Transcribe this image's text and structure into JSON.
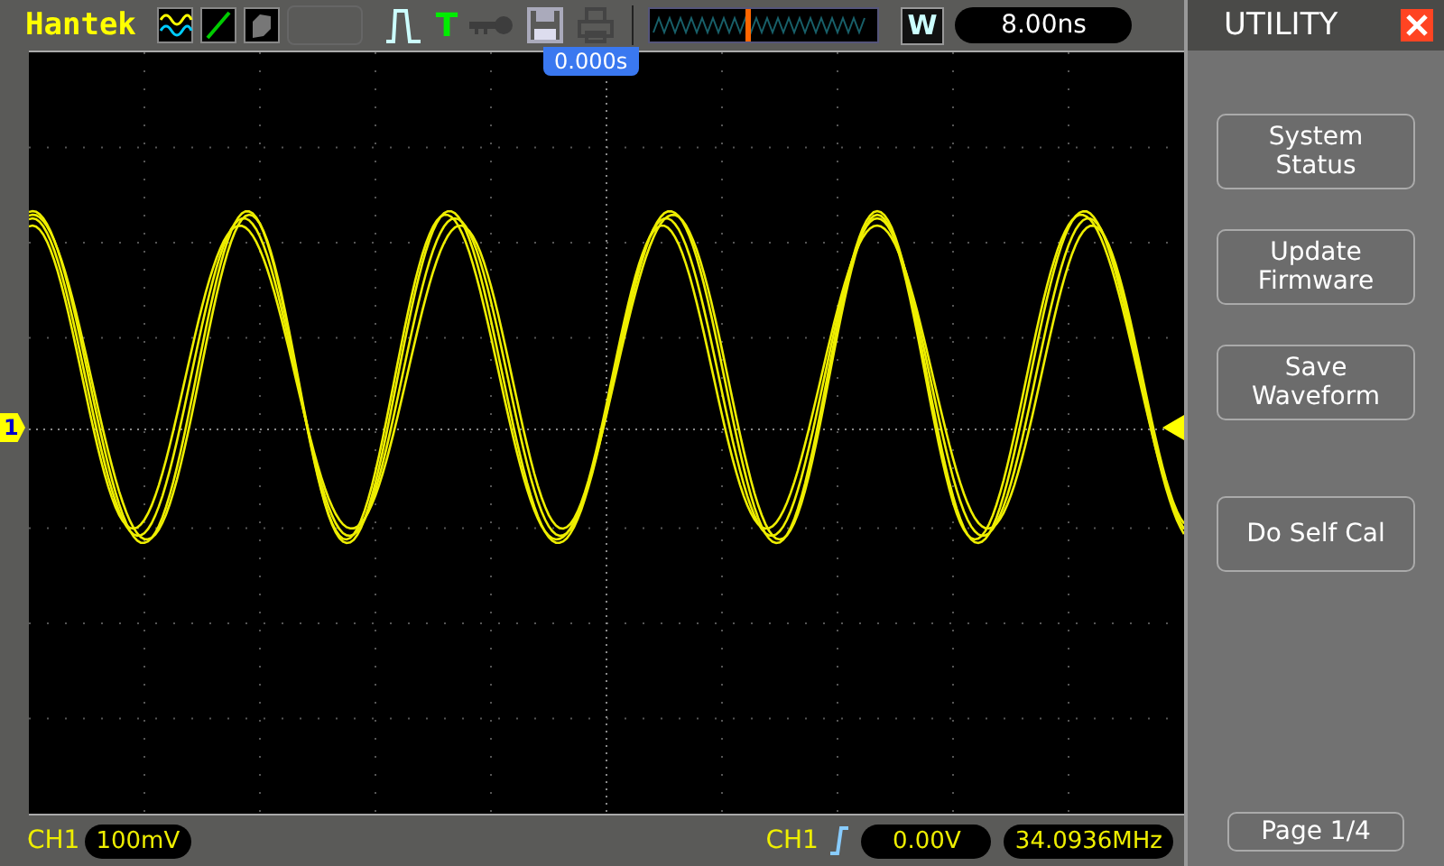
{
  "toolbar": {
    "brand": "Hantek",
    "trigger_status": "T",
    "window_mode": "W",
    "timebase": "8.00ns"
  },
  "plot": {
    "trigger_time": "0.000s",
    "channel_marker": "1"
  },
  "status_bar": {
    "channel": "CH1",
    "channel_scale": "100mV",
    "trigger_source": "CH1",
    "trigger_level": "0.00V",
    "frequency": "34.0936MHz"
  },
  "menu": {
    "title": "UTILITY",
    "items": [
      {
        "label": "System Status"
      },
      {
        "label": "Update Firmware"
      },
      {
        "label": "Save Waveform"
      },
      {
        "label": "Do Self Cal"
      }
    ],
    "page": "Page 1/4"
  }
}
